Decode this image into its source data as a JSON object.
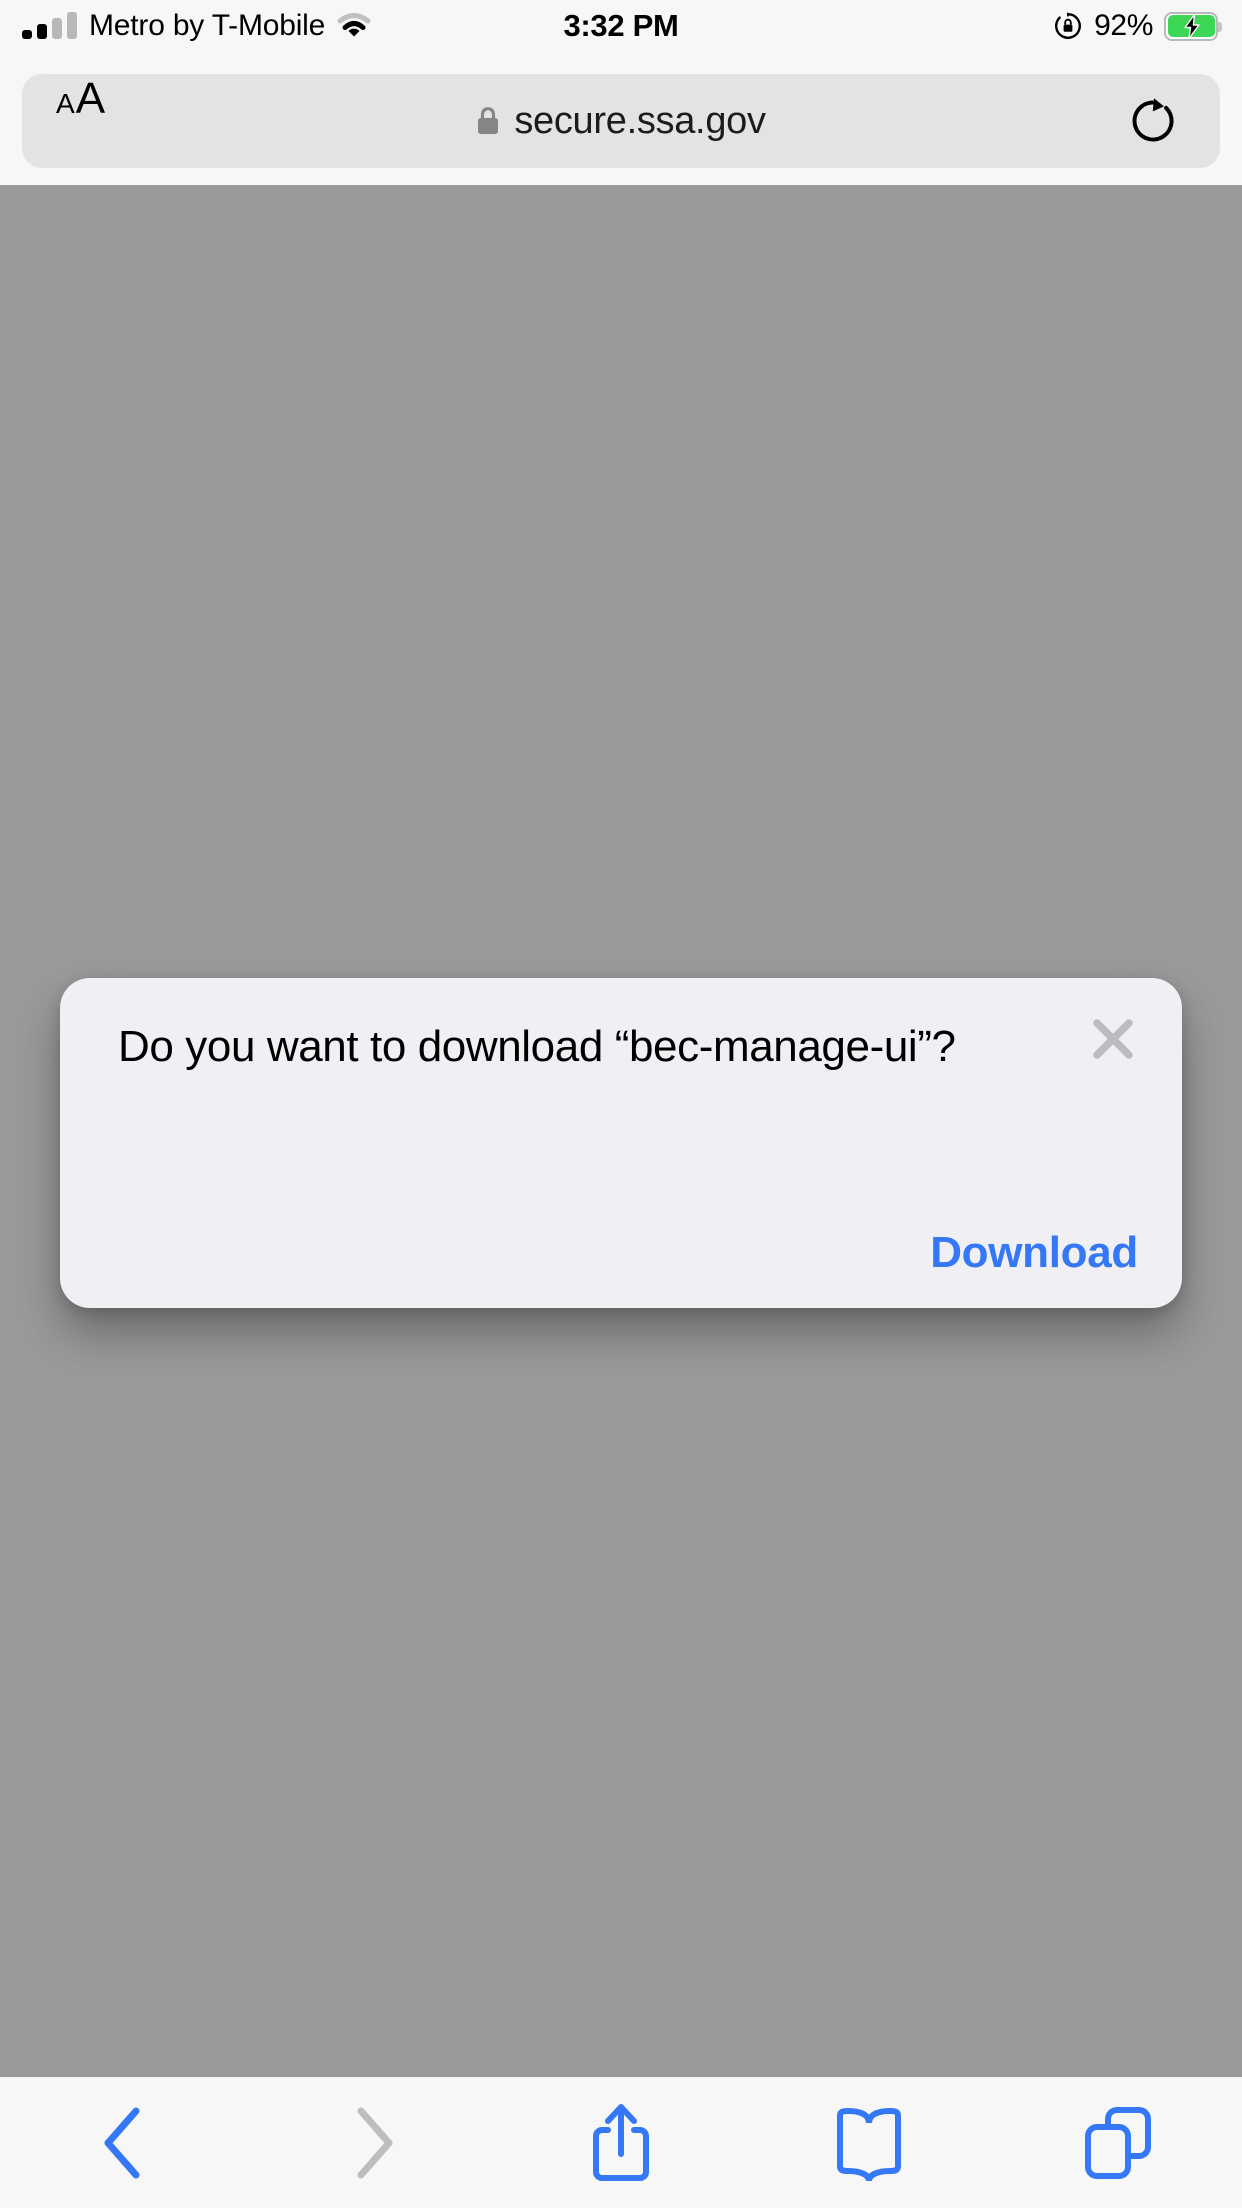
{
  "status_bar": {
    "carrier": "Metro by T-Mobile",
    "time": "3:32 PM",
    "battery_percent": "92%",
    "signal_bars_filled": 2,
    "signal_bars_total": 4,
    "wifi_icon": "wifi-icon",
    "rotation_lock_icon": "rotation-lock-icon",
    "battery_icon": "battery-charging-icon",
    "battery_color": "#3bd755"
  },
  "browser": {
    "page_settings_label_small": "A",
    "page_settings_label_large": "A",
    "lock_icon": "lock-icon",
    "url": "secure.ssa.gov",
    "reload_icon": "reload-icon",
    "chrome_bg": "#f7f7f7",
    "url_pill_bg": "#e3e3e3"
  },
  "page": {
    "background_color": "#9a9a9a"
  },
  "dialog": {
    "message": "Do you want to download “bec-manage-ui”?",
    "download_label": "Download",
    "close_icon": "close-icon",
    "accent_color": "#3478f6",
    "background_color": "#f0eff4",
    "close_icon_color": "#bcbbc2"
  },
  "toolbar": {
    "items": [
      {
        "name": "back-button",
        "icon": "chevron-left-icon",
        "enabled": true
      },
      {
        "name": "forward-button",
        "icon": "chevron-right-icon",
        "enabled": false
      },
      {
        "name": "share-button",
        "icon": "share-icon",
        "enabled": true
      },
      {
        "name": "bookmarks-button",
        "icon": "book-icon",
        "enabled": true
      },
      {
        "name": "tabs-button",
        "icon": "tabs-icon",
        "enabled": true
      }
    ],
    "enabled_color": "#3478f6",
    "disabled_color": "#bdbdbd",
    "background_color": "#f7f7f7"
  }
}
